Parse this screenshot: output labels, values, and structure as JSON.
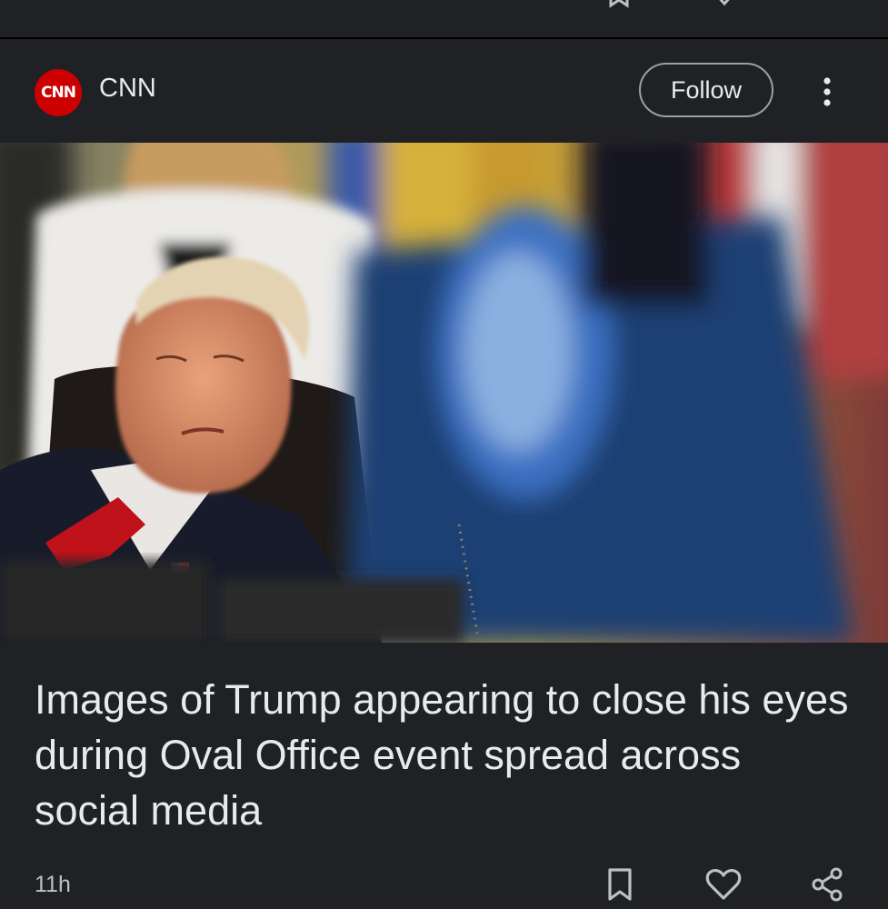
{
  "top_actions": [
    "bookmark-icon",
    "heart-icon",
    "share-icon"
  ],
  "source": {
    "logo_text": "CNN",
    "name": "CNN",
    "follow_label": "Follow",
    "brand_color": "#cc0000"
  },
  "article": {
    "headline": "Images of Trump appearing to close his eyes during Oval Office event spread across social media",
    "timestamp": "11h",
    "image_icon": "news-photo"
  },
  "actions": [
    "bookmark-icon",
    "heart-icon",
    "share-icon"
  ],
  "theme": {
    "background": "#202124",
    "text": "#e8eaed",
    "muted": "#bdc1c6"
  }
}
